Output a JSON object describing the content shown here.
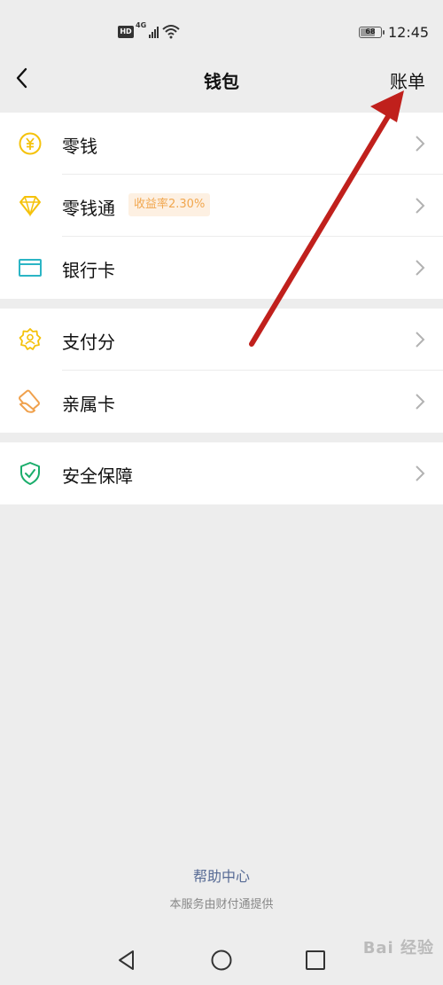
{
  "status_bar": {
    "hd": "HD",
    "network": "4G",
    "battery": "68",
    "time": "12:45"
  },
  "nav": {
    "title": "钱包",
    "right_action": "账单"
  },
  "groups": [
    {
      "items": [
        {
          "label": "零钱",
          "icon": "yuan-coin-icon"
        },
        {
          "label": "零钱通",
          "icon": "diamond-icon",
          "badge": "收益率2.30%"
        },
        {
          "label": "银行卡",
          "icon": "bank-card-icon"
        }
      ]
    },
    {
      "items": [
        {
          "label": "支付分",
          "icon": "pay-score-icon"
        },
        {
          "label": "亲属卡",
          "icon": "family-card-icon"
        }
      ]
    },
    {
      "items": [
        {
          "label": "安全保障",
          "icon": "shield-check-icon"
        }
      ]
    }
  ],
  "footer": {
    "help_link": "帮助中心",
    "service_text": "本服务由财付通提供"
  },
  "watermark": "Bai 经验",
  "colors": {
    "background": "#ededed",
    "link": "#576b95",
    "yellow_icon": "#f5c20b",
    "teal_icon": "#2bb5c5",
    "orange_icon": "#f0a14d",
    "green_icon": "#1aad6b",
    "annotation_arrow": "#c0201c"
  }
}
